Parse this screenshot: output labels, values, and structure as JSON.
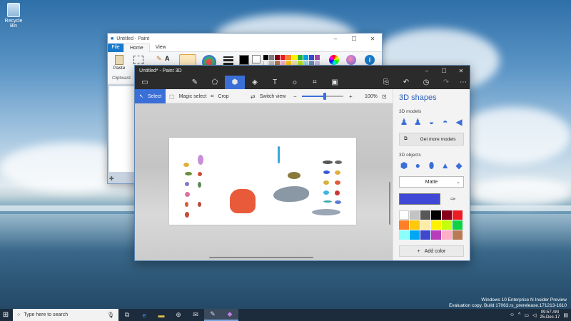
{
  "desktop": {
    "recycle_bin_label": "Recycle Bin",
    "watermark": [
      "Windows 10 Enterprise N Insider Preview",
      "Evaluation copy. Build 17063.rs_prerelease.171213-1610"
    ]
  },
  "paint": {
    "title": "Untitled - Paint",
    "tabs": {
      "file": "File",
      "home": "Home",
      "view": "View"
    },
    "paste_label": "Paste",
    "clipboard_label": "Clipboard",
    "window_controls": [
      "–",
      "☐",
      "✕"
    ]
  },
  "paint3d": {
    "title": "Untitled* - Paint 3D",
    "window_controls": [
      "–",
      "☐",
      "✕"
    ],
    "toolbar_icons": [
      "menu-icon",
      "brush-icon",
      "2d-shapes-icon",
      "3d-shapes-icon",
      "stickers-icon",
      "text-icon",
      "effects-icon",
      "canvas-icon",
      "3d-library-icon",
      "paste-icon",
      "undo-icon",
      "history-icon",
      "redo-icon",
      "more-icon"
    ],
    "subtoolbar": {
      "select": "Select",
      "magic_select": "Magic select",
      "crop": "Crop",
      "switch_view": "Switch view",
      "zoom_percent": "100%",
      "zoom_level": 0.55
    },
    "panel": {
      "title": "3D shapes",
      "models_label": "3D models",
      "get_more": "Get more models",
      "objects_label": "3D objects",
      "material": "Matte",
      "add_color": "Add color",
      "current_color": "#4048d6",
      "palette": [
        "#ffffff",
        "#c3c3c3",
        "#585858",
        "#000000",
        "#88001b",
        "#ec1c24",
        "#ff7f27",
        "#ffc90e",
        "#fdeca6",
        "#fff200",
        "#c4ff0e",
        "#0ed145",
        "#8cfffb",
        "#00a8f3",
        "#3f48cc",
        "#b83dba",
        "#ffaec8",
        "#b97a56"
      ]
    }
  },
  "taskbar": {
    "search_placeholder": "Type here to search",
    "time": "09:57 AM",
    "date": "25-Dec-17"
  }
}
